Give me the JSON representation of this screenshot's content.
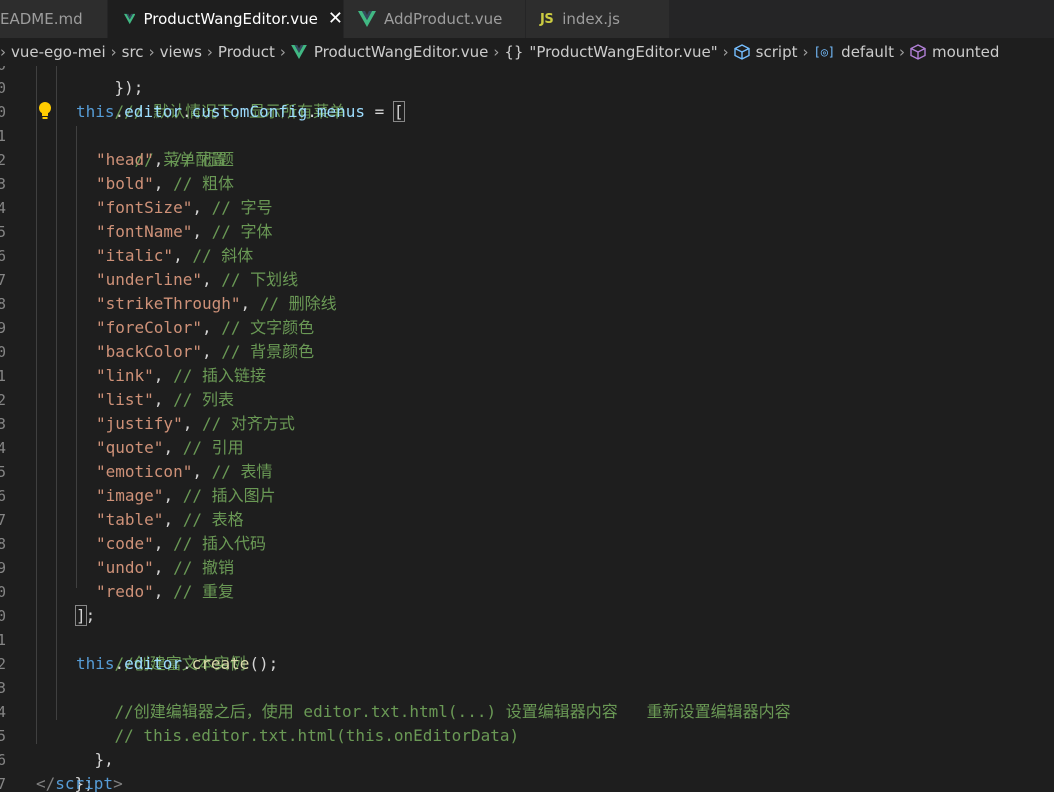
{
  "tabs": [
    {
      "label": "EADME.md",
      "icon": "markdown-file-icon",
      "active": false
    },
    {
      "label": "ProductWangEditor.vue",
      "icon": "vue-logo-icon",
      "active": true
    },
    {
      "label": "AddProduct.vue",
      "icon": "vue-logo-icon",
      "active": false
    },
    {
      "label": "index.js",
      "icon": "js-file-icon",
      "icon_text": "JS",
      "active": false
    }
  ],
  "close_glyph": "✕",
  "breadcrumb": {
    "sep": "›",
    "items": [
      "vue-ego-mei",
      "src",
      "views",
      "Product",
      "ProductWangEditor.vue",
      "\"ProductWangEditor.vue\"",
      "script",
      "default",
      "mounted"
    ],
    "braces": "{}",
    "brackets_icon_text": "[◎]"
  },
  "line_numbers": [
    "0",
    "0",
    "0",
    "1",
    "2",
    "3",
    "4",
    "5",
    "6",
    "7",
    "8",
    "9",
    "0",
    "1",
    "2",
    "3",
    "4",
    "5",
    "6",
    "7",
    "8",
    "9",
    "0",
    "0",
    "1",
    "2",
    "3",
    "4",
    "5",
    "6",
    "7",
    "8"
  ],
  "code": {
    "l0": {
      "text": "});"
    },
    "l1": {
      "comment": "/// 默认情况下，显示所有菜单"
    },
    "l2": {
      "this": "this",
      "dot1": ".",
      "p1": "editor",
      "dot2": ".",
      "p2": "customConfig",
      "dot3": ".",
      "p3": "menus",
      "eq": " = ",
      "br": "["
    },
    "l3": {
      "comment": "// 菜单配置"
    },
    "items": [
      {
        "str": "\"head\"",
        "comment": "// 标题"
      },
      {
        "str": "\"bold\"",
        "comment": "// 粗体"
      },
      {
        "str": "\"fontSize\"",
        "comment": "// 字号"
      },
      {
        "str": "\"fontName\"",
        "comment": "// 字体"
      },
      {
        "str": "\"italic\"",
        "comment": "// 斜体"
      },
      {
        "str": "\"underline\"",
        "comment": "// 下划线"
      },
      {
        "str": "\"strikeThrough\"",
        "comment": "// 删除线"
      },
      {
        "str": "\"foreColor\"",
        "comment": "// 文字颜色"
      },
      {
        "str": "\"backColor\"",
        "comment": "// 背景颜色"
      },
      {
        "str": "\"link\"",
        "comment": "// 插入链接"
      },
      {
        "str": "\"list\"",
        "comment": "// 列表"
      },
      {
        "str": "\"justify\"",
        "comment": "// 对齐方式"
      },
      {
        "str": "\"quote\"",
        "comment": "// 引用"
      },
      {
        "str": "\"emoticon\"",
        "comment": "// 表情"
      },
      {
        "str": "\"image\"",
        "comment": "// 插入图片"
      },
      {
        "str": "\"table\"",
        "comment": "// 表格"
      },
      {
        "str": "\"code\"",
        "comment": "// 插入代码"
      },
      {
        "str": "\"undo\"",
        "comment": "// 撤销"
      },
      {
        "str": "\"redo\"",
        "comment": "// 重复"
      }
    ],
    "comma": ", ",
    "close_arr": {
      "br": "]",
      "semi": ";"
    },
    "c_create": {
      "comment": "//创建富文本实例"
    },
    "create": {
      "this": "this",
      "dot1": ".",
      "p1": "editor",
      "dot2": ".",
      "fn": "create",
      "rest": "();"
    },
    "c_after": {
      "comment": "//创建编辑器之后，使用 editor.txt.html(...) 设置编辑器内容   重新设置编辑器内容"
    },
    "c_html": {
      "comment": "// this.editor.txt.html(this.onEditorData)"
    },
    "close_method": {
      "text": "},"
    },
    "close_obj": {
      "text": "};"
    },
    "end_tag": {
      "open": "</",
      "name": "script",
      "close": ">"
    }
  },
  "colors": {
    "background": "#1e1e1e",
    "tabbar": "#252526",
    "comment": "#6a9955",
    "string": "#ce9178",
    "keyword": "#569cd6",
    "property": "#9cdcfe",
    "function": "#dcdcaa",
    "vue_green": "#41b883",
    "lightbulb": "#ffcc00"
  }
}
